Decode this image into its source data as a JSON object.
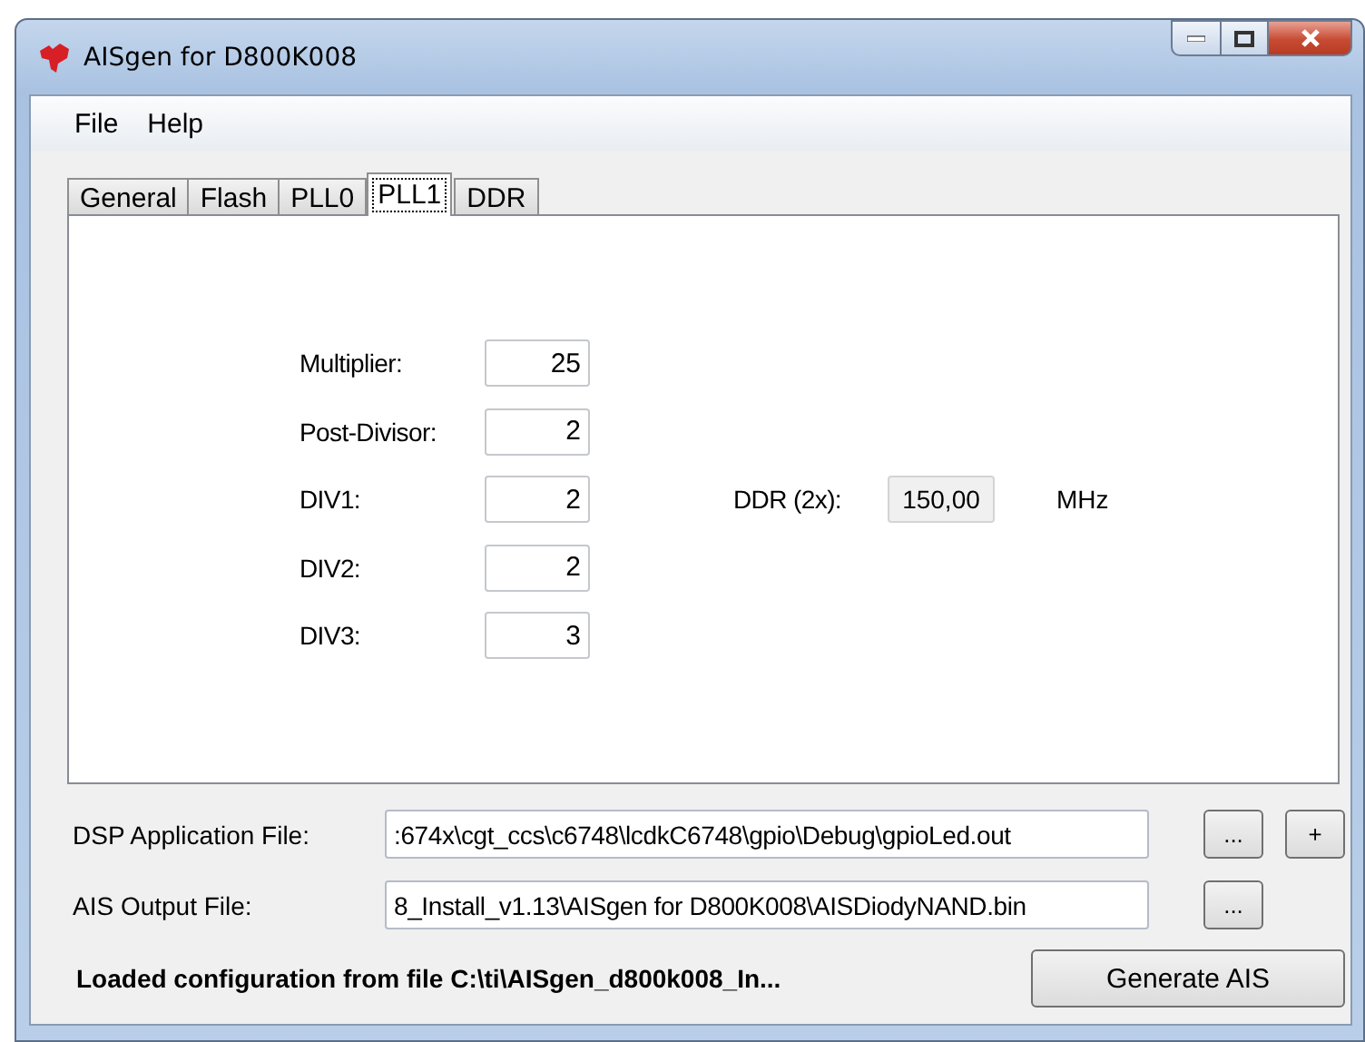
{
  "window": {
    "title": "AISgen for D800K008"
  },
  "menu": [
    "File",
    "Help"
  ],
  "tabs": [
    {
      "label": "General",
      "selected": false
    },
    {
      "label": "Flash",
      "selected": false
    },
    {
      "label": "PLL0",
      "selected": false
    },
    {
      "label": "PLL1",
      "selected": true
    },
    {
      "label": "DDR",
      "selected": false
    }
  ],
  "pll_fields": [
    {
      "label": "Multiplier:",
      "value": "25"
    },
    {
      "label": "Post-Divisor:",
      "value": "2"
    },
    {
      "label": "DIV1:",
      "value": "2"
    },
    {
      "label": "DIV2:",
      "value": "2"
    },
    {
      "label": "DIV3:",
      "value": "3"
    }
  ],
  "ddr": {
    "label": "DDR (2x):",
    "value": "150,00",
    "unit": "MHz"
  },
  "files": [
    {
      "label": "DSP Application File:",
      "value": ":674x\\cgt_ccs\\c6748\\lcdkC6748\\gpio\\Debug\\gpioLed.out",
      "buttons": [
        "...",
        "+"
      ]
    },
    {
      "label": "AIS Output File:",
      "value": "8_Install_v1.13\\AISgen for D800K008\\AISDiodyNAND.bin",
      "buttons": [
        "..."
      ]
    }
  ],
  "status": "Loaded configuration from file C:\\ti\\AISgen_d800k008_In...",
  "generate_button": "Generate AIS"
}
